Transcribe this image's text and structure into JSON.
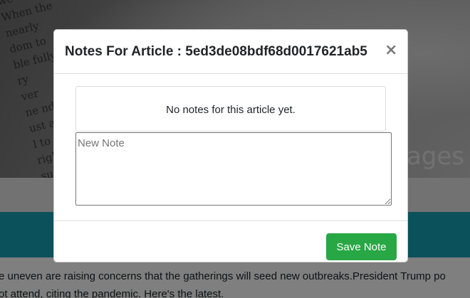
{
  "background": {
    "hero_text_lines": [
      "we",
      "When the",
      "nearly",
      "dom to",
      "ble fully",
      "ry",
      "ver",
      "ne nd",
      "ust as",
      "l to",
      "right to",
      "sure"
    ],
    "hero_word": "mages",
    "article_lines": [
      "e uneven are raising concerns that the gatherings will seed new outbreaks.President Trump po",
      "ot attend, citing the pandemic. Here's the latest."
    ]
  },
  "modal": {
    "title": "Notes For Article : 5ed3de08bdf68d0017621ab5",
    "close_label": "×",
    "empty_message": "No notes for this article yet.",
    "note_placeholder": "New Note",
    "note_value": "",
    "save_label": "Save Note"
  },
  "colors": {
    "backdrop": "#000000",
    "teal_band": "#17a2b8",
    "save_button": "#28a745"
  },
  "icons": {
    "close": "close-icon"
  }
}
